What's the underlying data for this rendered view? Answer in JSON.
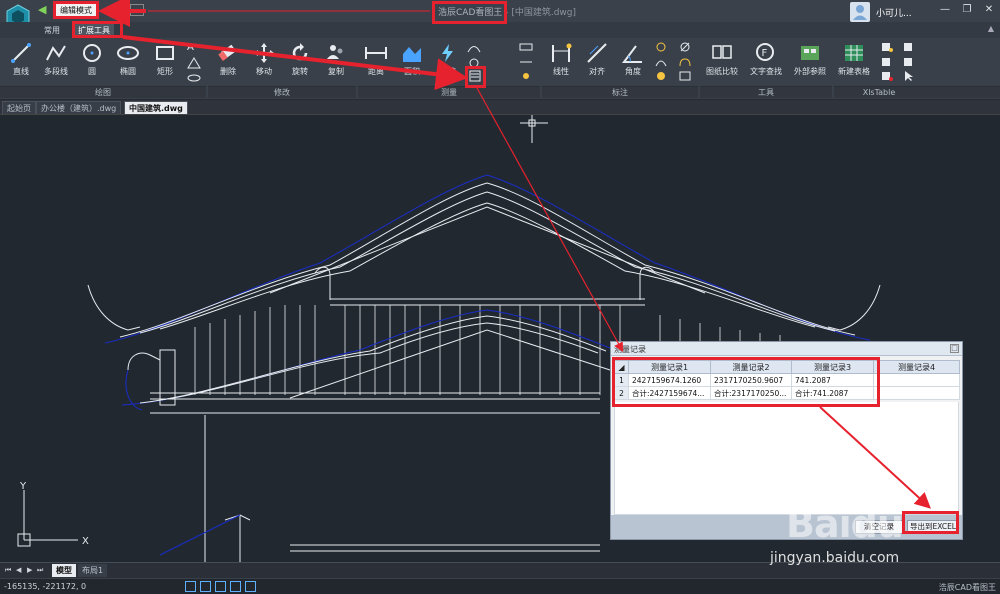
{
  "app": {
    "mode_button": "编辑模式",
    "window_title": "浩辰CAD看图王",
    "window_title_file": " - [中国建筑.dwg]",
    "user_name": "小可儿..."
  },
  "ribbon_tabs": [
    {
      "label": "常用"
    },
    {
      "label": "扩展工具"
    }
  ],
  "ribbon": {
    "draw": {
      "group_label": "绘图",
      "tools": [
        {
          "label": "直线",
          "icon": "line-icon"
        },
        {
          "label": "多段线",
          "icon": "polyline-icon"
        },
        {
          "label": "圆",
          "icon": "circle-icon"
        },
        {
          "label": "椭圆",
          "icon": "ellipse-icon"
        },
        {
          "label": "矩形",
          "icon": "rectangle-icon"
        }
      ]
    },
    "modify": {
      "group_label": "修改",
      "tools": [
        {
          "label": "删除",
          "icon": "eraser-icon"
        },
        {
          "label": "移动",
          "icon": "move-icon"
        },
        {
          "label": "旋转",
          "icon": "rotate-icon"
        },
        {
          "label": "复制",
          "icon": "copy-icon"
        }
      ]
    },
    "measure": {
      "group_label": "测量",
      "tools": [
        {
          "label": "距离",
          "icon": "distance-icon"
        },
        {
          "label": "面积",
          "icon": "area-icon"
        },
        {
          "label": "快速",
          "icon": "quick-measure-icon"
        }
      ]
    },
    "annotate": {
      "group_label": "标注",
      "tools": [
        {
          "label": "线性",
          "icon": "linear-dim-icon"
        },
        {
          "label": "对齐",
          "icon": "aligned-dim-icon"
        },
        {
          "label": "角度",
          "icon": "angle-dim-icon"
        }
      ]
    },
    "tools": {
      "group_label": "工具",
      "tools": [
        {
          "label": "图纸比较",
          "icon": "compare-icon"
        },
        {
          "label": "文字查找",
          "icon": "text-find-icon"
        },
        {
          "label": "外部参照",
          "icon": "xref-icon"
        }
      ]
    },
    "xls": {
      "group_label": "XlsTable",
      "tools": [
        {
          "label": "新建表格",
          "icon": "new-table-icon"
        }
      ]
    }
  },
  "doc_tabs": [
    {
      "label": "起始页"
    },
    {
      "label": "办公楼（建筑）.dwg"
    },
    {
      "label": "中国建筑.dwg"
    }
  ],
  "measure_dialog": {
    "title": "测量记录",
    "columns": [
      "测量记录1",
      "测量记录2",
      "测量记录3",
      "测量记录4"
    ],
    "rows": [
      {
        "index": "1",
        "cells": [
          "2427159674.1260",
          "2317170250.9607",
          "741.2087",
          ""
        ]
      },
      {
        "index": "2",
        "cells": [
          "合计:2427159674...",
          "合计:2317170250...",
          "合计:741.2087",
          ""
        ]
      }
    ],
    "buttons": [
      "清空记录",
      "导出到EXCEL"
    ]
  },
  "layout_tabs": [
    {
      "label": "模型"
    },
    {
      "label": "布局1"
    }
  ],
  "status": {
    "coordinates": "-165135, -221172, 0",
    "app_name": "浩辰CAD看图王"
  },
  "watermark": {
    "text": "Baidu",
    "url": "jingyan.baidu.com"
  },
  "colors": {
    "highlight": "#e6222e",
    "canvas_bg": "#212830",
    "drawing_line": "#ffffff",
    "drawing_outline": "#1a2ec8"
  }
}
